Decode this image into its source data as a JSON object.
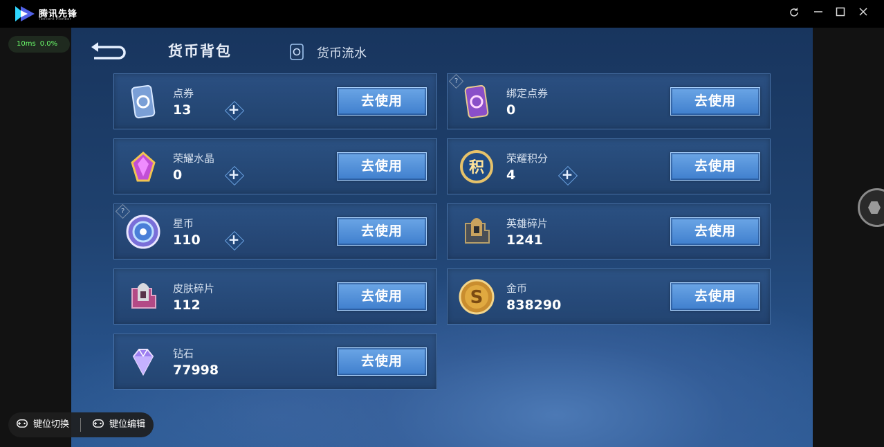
{
  "window": {
    "app_name": "腾讯先锋",
    "app_name_en": "Tencent Pioneer",
    "controls": [
      "refresh-icon",
      "minimize-icon",
      "maximize-icon",
      "close-icon"
    ]
  },
  "perf": {
    "latency": "10ms",
    "loss": "0.0%"
  },
  "nav": {
    "active_tab": "货币背包",
    "secondary_tab": "货币流水"
  },
  "currencies": [
    {
      "id": "dianquan",
      "name": "点券",
      "value": "13",
      "button": "去使用",
      "has_plus": true,
      "has_help": false,
      "icon": "ticket-card-icon"
    },
    {
      "id": "bangding",
      "name": "绑定点券",
      "value": "0",
      "button": "去使用",
      "has_plus": false,
      "has_help": true,
      "icon": "bound-ticket-icon"
    },
    {
      "id": "shuijing",
      "name": "荣耀水晶",
      "value": "0",
      "button": "去使用",
      "has_plus": true,
      "has_help": false,
      "icon": "crystal-icon"
    },
    {
      "id": "jifen",
      "name": "荣耀积分",
      "value": "4",
      "button": "去使用",
      "has_plus": true,
      "has_help": false,
      "icon": "honor-points-icon"
    },
    {
      "id": "xingbi",
      "name": "星币",
      "value": "110",
      "button": "去使用",
      "has_plus": true,
      "has_help": true,
      "icon": "star-coin-icon"
    },
    {
      "id": "yingxiong",
      "name": "英雄碎片",
      "value": "1241",
      "button": "去使用",
      "has_plus": false,
      "has_help": false,
      "icon": "hero-fragment-icon"
    },
    {
      "id": "pifu",
      "name": "皮肤碎片",
      "value": "112",
      "button": "去使用",
      "has_plus": false,
      "has_help": false,
      "icon": "skin-fragment-icon"
    },
    {
      "id": "jinbi",
      "name": "金币",
      "value": "838290",
      "button": "去使用",
      "has_plus": false,
      "has_help": false,
      "icon": "gold-coin-icon"
    },
    {
      "id": "zuanshi",
      "name": "钻石",
      "value": "77998",
      "button": "去使用",
      "has_plus": false,
      "has_help": false,
      "icon": "diamond-icon"
    }
  ],
  "help_glyph": "?",
  "plus_glyph": "+",
  "bottom_bar": {
    "switch_label": "键位切换",
    "edit_label": "键位编辑"
  },
  "colors": {
    "accent_button": "#4f8fd9",
    "background": "#1f416e",
    "perf_text": "#6cff6c"
  }
}
